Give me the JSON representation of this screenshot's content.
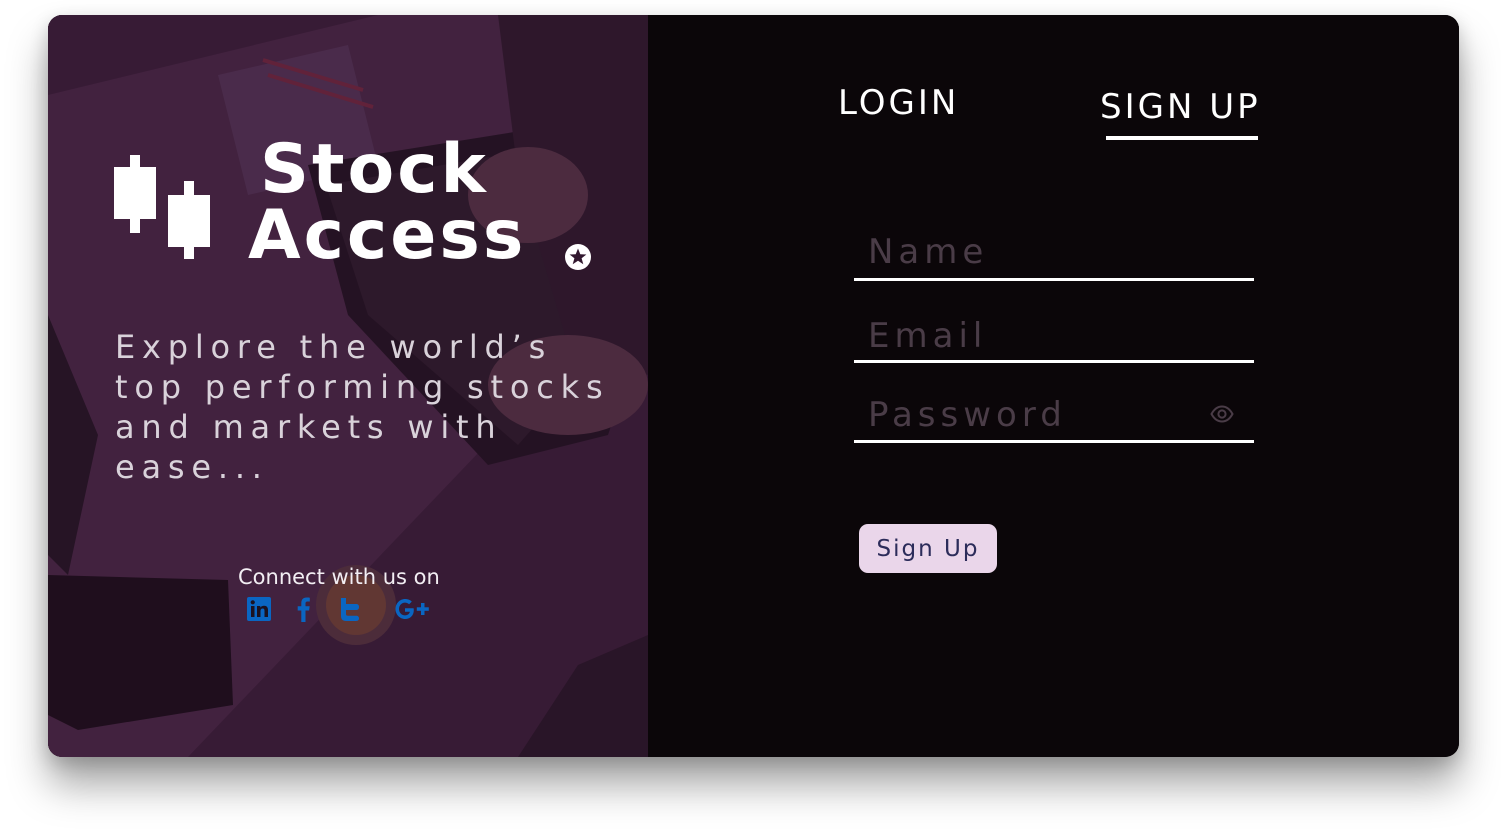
{
  "brand": {
    "name_line1": "Stock",
    "name_line2": "Access",
    "tagline": "Explore the world’s top performing stocks and markets with ease..."
  },
  "social": {
    "connect_label": "Connect with us on",
    "icons": [
      "linkedin-icon",
      "facebook-icon",
      "twitter-icon",
      "google-plus-icon"
    ],
    "icon_color": "#0a66c2"
  },
  "tabs": {
    "login_label": "LOGIN",
    "signup_label": "SIGN UP",
    "active": "SIGN UP"
  },
  "form": {
    "name_placeholder": "Name",
    "email_placeholder": "Email",
    "password_placeholder": "Password",
    "name_value": "",
    "email_value": "",
    "password_value": "",
    "submit_label": "Sign Up"
  },
  "colors": {
    "left_panel": "#32182f",
    "right_panel": "#0b0609",
    "button_bg": "#ead6ea",
    "button_text": "#2c2c5a",
    "placeholder": "#4a3c47"
  }
}
